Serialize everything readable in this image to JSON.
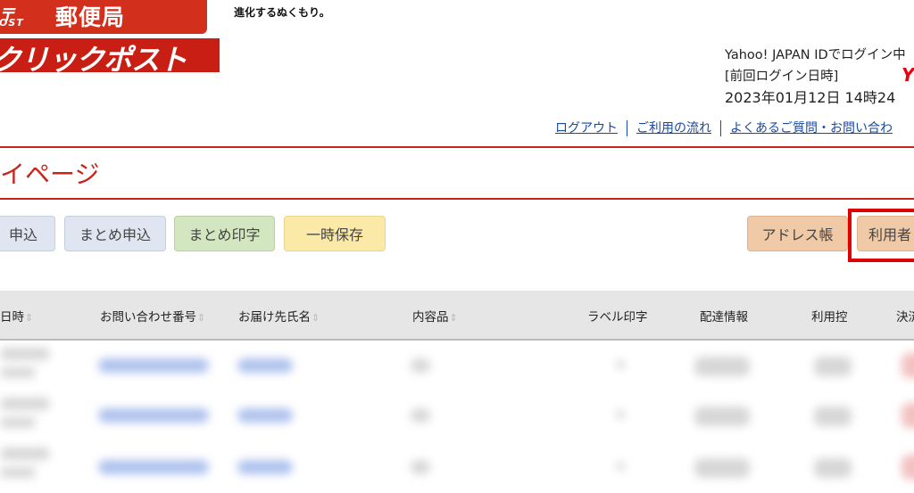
{
  "header": {
    "logo_post_mark": "〒",
    "logo_post_text": "OST",
    "logo_office": "郵便局",
    "logo_service": "クリックポスト",
    "tagline": "進化するぬくもり。"
  },
  "login": {
    "line1": "Yahoo! JAPAN IDでログイン中",
    "line2": "[前回ログイン日時]",
    "line3": "2023年01月12日 14時24",
    "yahoo_mark": "Y"
  },
  "links": [
    {
      "label": "ログアウト"
    },
    {
      "label": "ご利用の流れ"
    },
    {
      "label": "よくあるご質問・お問い合わ"
    }
  ],
  "page_title": "イページ",
  "buttons": {
    "apply": "申込",
    "bulk_apply": "まとめ申込",
    "bulk_print": "まとめ印字",
    "temp_save": "一時保存",
    "address_book": "アドレス帳",
    "user": "利用者"
  },
  "table": {
    "headers": [
      {
        "label": "日時",
        "sortable": true
      },
      {
        "label": "お問い合わせ番号",
        "sortable": true
      },
      {
        "label": "お届け先氏名",
        "sortable": true
      },
      {
        "label": "内容品",
        "sortable": true
      },
      {
        "label": "ラベル印字",
        "sortable": false
      },
      {
        "label": "配達情報",
        "sortable": false
      },
      {
        "label": "利用控",
        "sortable": false
      },
      {
        "label": "決済",
        "sortable": false
      }
    ],
    "sort_icon": "⇕",
    "rows_note_hidden": true
  },
  "colors": {
    "brand_red": "#c8241b",
    "highlight_red": "#e10000",
    "link_blue": "#1a4aa0"
  }
}
